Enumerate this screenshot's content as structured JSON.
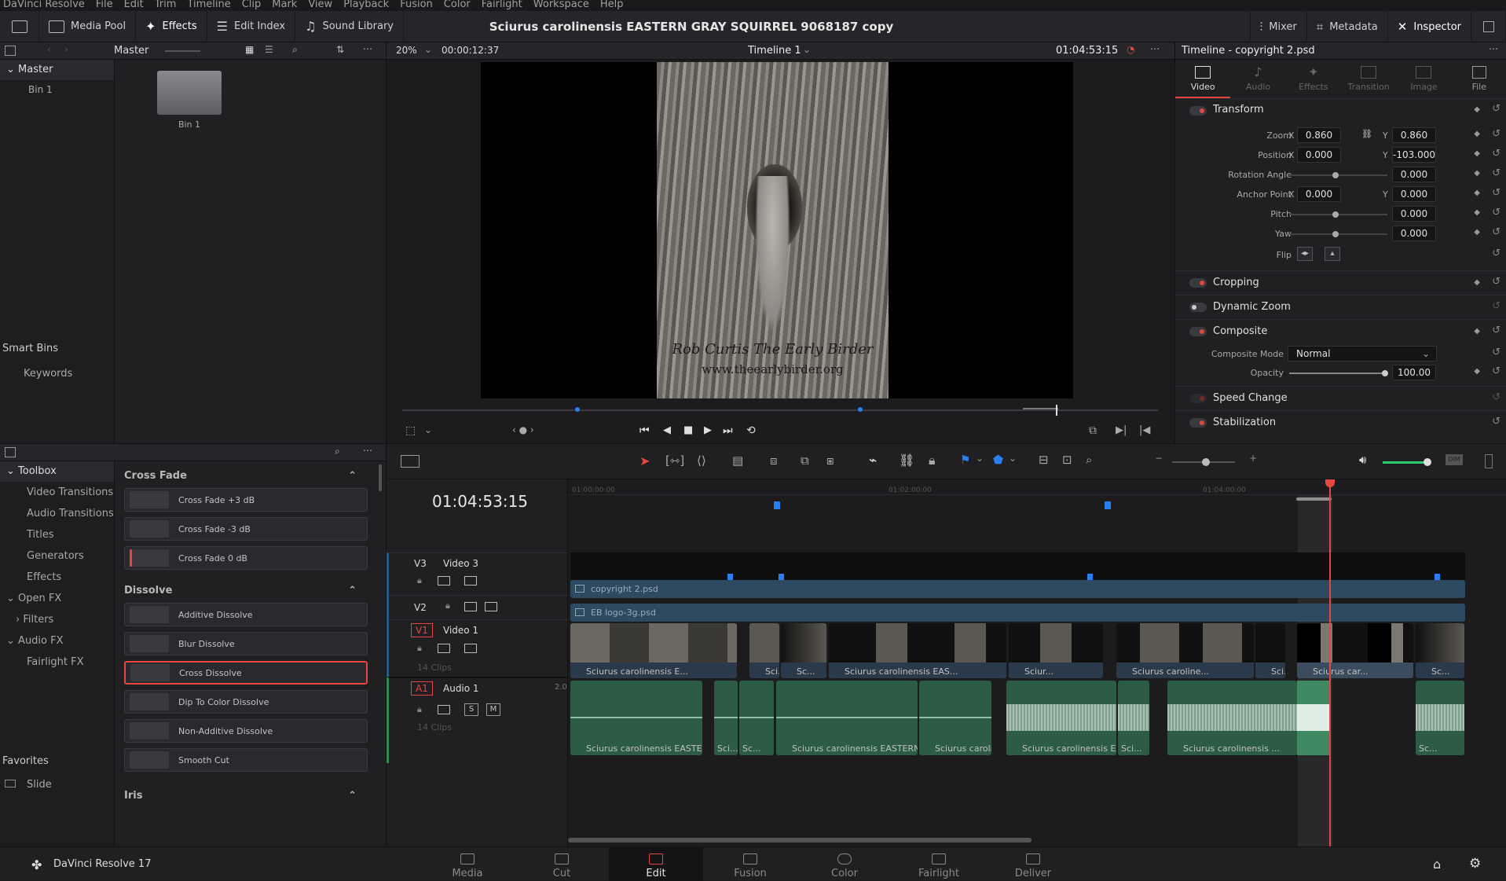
{
  "menu": [
    "DaVinci Resolve",
    "File",
    "Edit",
    "Trim",
    "Timeline",
    "Clip",
    "Mark",
    "View",
    "Playback",
    "Fusion",
    "Color",
    "Fairlight",
    "Workspace",
    "Help"
  ],
  "topbar": {
    "media_pool": "Media Pool",
    "effects": "Effects",
    "edit_index": "Edit Index",
    "sound_library": "Sound Library",
    "title": "Sciurus carolinensis  EASTERN GRAY SQUIRREL 9068187 copy",
    "mixer": "Mixer",
    "metadata": "Metadata",
    "inspector": "Inspector"
  },
  "media_pool": {
    "header": "Master",
    "tree_root": "Master",
    "tree_child": "Bin 1",
    "bin_name": "Bin 1",
    "smart_bins": "Smart Bins",
    "keywords": "Keywords"
  },
  "viewer": {
    "zoom": "20%",
    "duration": "00:00:12:37",
    "timeline_name": "Timeline 1",
    "timecode": "01:04:53:15",
    "watermark_line1": "Rob Curtis The Early Birder",
    "watermark_line2": "www.theearlybirder.org"
  },
  "effects": {
    "toolbox": "Toolbox",
    "tree": [
      {
        "label": "Video Transitions",
        "indent": true
      },
      {
        "label": "Audio Transitions",
        "indent": true
      },
      {
        "label": "Titles",
        "indent": true
      },
      {
        "label": "Generators",
        "indent": true
      },
      {
        "label": "Effects",
        "indent": true
      }
    ],
    "open_fx": "Open FX",
    "filters": "Filters",
    "audio_fx": "Audio FX",
    "fairlight_fx": "Fairlight FX",
    "favorites": "Favorites",
    "slide": "Slide",
    "sections": [
      {
        "title": "Cross Fade",
        "items": [
          "Cross Fade +3 dB",
          "Cross Fade -3 dB",
          "Cross Fade 0 dB"
        ]
      },
      {
        "title": "Dissolve",
        "items": [
          "Additive Dissolve",
          "Blur Dissolve",
          "Cross Dissolve",
          "Dip To Color Dissolve",
          "Non-Additive Dissolve",
          "Smooth Cut"
        ]
      },
      {
        "title": "Iris",
        "items": []
      }
    ],
    "selected": "Cross Dissolve"
  },
  "inspector": {
    "header": "Timeline - copyright 2.psd",
    "tabs": [
      "Video",
      "Audio",
      "Effects",
      "Transition",
      "Image",
      "File"
    ],
    "transform": "Transform",
    "zoom_label": "Zoom",
    "zoom_x": "0.860",
    "zoom_y": "0.860",
    "position_label": "Position",
    "position_x": "0.000",
    "position_y": "-103.000",
    "rotation_label": "Rotation Angle",
    "rotation": "0.000",
    "anchor_label": "Anchor Point",
    "anchor_x": "0.000",
    "anchor_y": "0.000",
    "pitch_label": "Pitch",
    "pitch": "0.000",
    "yaw_label": "Yaw",
    "yaw": "0.000",
    "flip_label": "Flip",
    "x": "X",
    "y": "Y",
    "cropping": "Cropping",
    "dynamic_zoom": "Dynamic Zoom",
    "composite": "Composite",
    "composite_mode_label": "Composite Mode",
    "composite_mode": "Normal",
    "opacity_label": "Opacity",
    "opacity": "100.00",
    "speed_change": "Speed Change",
    "stabilization": "Stabilization"
  },
  "timeline": {
    "timecode": "01:04:53:15",
    "ruler": [
      "01:00:00:00",
      "01:02:00:00",
      "01:04:00:00"
    ],
    "v3": {
      "id": "V3",
      "name": "Video 3"
    },
    "v2": {
      "id": "V2"
    },
    "v1": {
      "id": "V1",
      "name": "Video 1",
      "clips": "14 Clips"
    },
    "a1": {
      "id": "A1",
      "name": "Audio 1",
      "ch": "2.0",
      "clips": "14 Clips",
      "s": "S",
      "m": "M"
    },
    "copyright_clip": "copyright 2.psd",
    "logo_clip": "EB logo-3g.psd",
    "video_clips": [
      "Sciurus carolinensis  E...",
      "Sci...",
      "Sc...",
      "Sciurus carolinensis  EAS...",
      "Sciur...",
      "Sciurus caroline...",
      "Sci...",
      "Sciurus car...",
      "Sc..."
    ],
    "audio_clips": [
      "Sciurus carolinensis  EASTERN G...",
      "Sci...",
      "Sc...",
      "Sciurus carolinensis  EASTERN GR...",
      "Sciurus carolin...",
      "Sciurus carolinensis  EAS...",
      "Sci...",
      "Sciurus carolinensis ...",
      "Sc..."
    ]
  },
  "footer": {
    "app": "DaVinci Resolve 17",
    "pages": [
      "Media",
      "Cut",
      "Edit",
      "Fusion",
      "Color",
      "Fairlight",
      "Deliver"
    ],
    "active": "Edit"
  }
}
